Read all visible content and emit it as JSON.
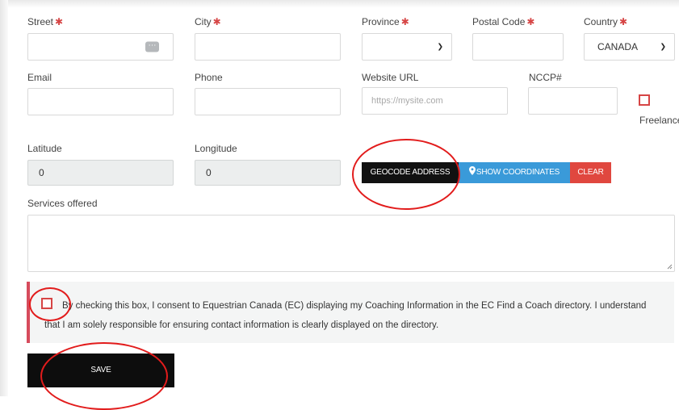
{
  "address": {
    "street_label": "Street",
    "city_label": "City",
    "province_label": "Province",
    "postal_label": "Postal Code",
    "country_label": "Country",
    "required_mark": "✱",
    "country_value": "CANADA",
    "autofill_icon": "dots-icon"
  },
  "contact": {
    "email_label": "Email",
    "phone_label": "Phone",
    "website_label": "Website URL",
    "website_placeholder": "https://mysite.com",
    "nccp_label": "NCCP#",
    "freelance_label": "Freelance"
  },
  "geo": {
    "latitude_label": "Latitude",
    "latitude_value": "0",
    "longitude_label": "Longitude",
    "longitude_value": "0",
    "geocode_label": "GEOCODE ADDRESS",
    "show_coords_label": "SHOW COORDINATES",
    "show_coords_icon": "map-pin-icon",
    "clear_label": "CLEAR"
  },
  "services": {
    "label": "Services offered"
  },
  "consent": {
    "text": "By checking this box, I consent to Equestrian Canada (EC) displaying my Coaching Information in the EC Find a Coach directory. I understand that I am solely responsible for ensuring contact information is clearly displayed on the directory."
  },
  "actions": {
    "save_label": "SAVE"
  },
  "colors": {
    "required": "#d64545",
    "geocode_bg": "#111111",
    "show_coords_bg": "#3a9ad9",
    "clear_bg": "#e0473f",
    "save_bg": "#0d0d0d",
    "annotation": "#e21c1c"
  }
}
